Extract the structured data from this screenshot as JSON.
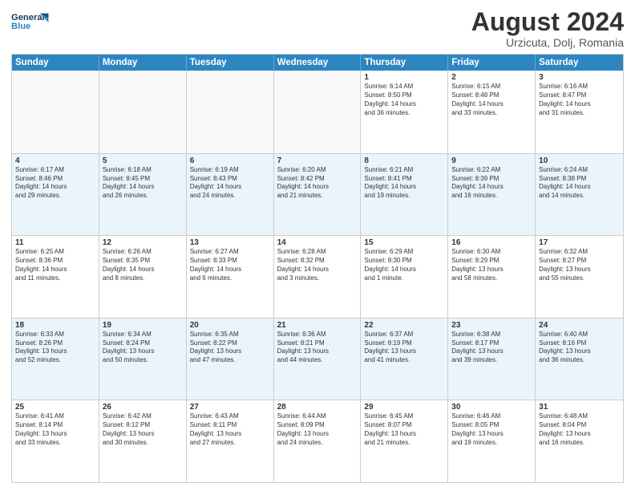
{
  "header": {
    "logo_general": "General",
    "logo_blue": "Blue",
    "month_year": "August 2024",
    "location": "Urzicuta, Dolj, Romania"
  },
  "days_of_week": [
    "Sunday",
    "Monday",
    "Tuesday",
    "Wednesday",
    "Thursday",
    "Friday",
    "Saturday"
  ],
  "weeks": [
    [
      {
        "day": "",
        "info": ""
      },
      {
        "day": "",
        "info": ""
      },
      {
        "day": "",
        "info": ""
      },
      {
        "day": "",
        "info": ""
      },
      {
        "day": "1",
        "info": "Sunrise: 6:14 AM\nSunset: 8:50 PM\nDaylight: 14 hours\nand 36 minutes."
      },
      {
        "day": "2",
        "info": "Sunrise: 6:15 AM\nSunset: 8:48 PM\nDaylight: 14 hours\nand 33 minutes."
      },
      {
        "day": "3",
        "info": "Sunrise: 6:16 AM\nSunset: 8:47 PM\nDaylight: 14 hours\nand 31 minutes."
      }
    ],
    [
      {
        "day": "4",
        "info": "Sunrise: 6:17 AM\nSunset: 8:46 PM\nDaylight: 14 hours\nand 29 minutes."
      },
      {
        "day": "5",
        "info": "Sunrise: 6:18 AM\nSunset: 8:45 PM\nDaylight: 14 hours\nand 26 minutes."
      },
      {
        "day": "6",
        "info": "Sunrise: 6:19 AM\nSunset: 8:43 PM\nDaylight: 14 hours\nand 24 minutes."
      },
      {
        "day": "7",
        "info": "Sunrise: 6:20 AM\nSunset: 8:42 PM\nDaylight: 14 hours\nand 21 minutes."
      },
      {
        "day": "8",
        "info": "Sunrise: 6:21 AM\nSunset: 8:41 PM\nDaylight: 14 hours\nand 19 minutes."
      },
      {
        "day": "9",
        "info": "Sunrise: 6:22 AM\nSunset: 8:39 PM\nDaylight: 14 hours\nand 16 minutes."
      },
      {
        "day": "10",
        "info": "Sunrise: 6:24 AM\nSunset: 8:38 PM\nDaylight: 14 hours\nand 14 minutes."
      }
    ],
    [
      {
        "day": "11",
        "info": "Sunrise: 6:25 AM\nSunset: 8:36 PM\nDaylight: 14 hours\nand 11 minutes."
      },
      {
        "day": "12",
        "info": "Sunrise: 6:26 AM\nSunset: 8:35 PM\nDaylight: 14 hours\nand 8 minutes."
      },
      {
        "day": "13",
        "info": "Sunrise: 6:27 AM\nSunset: 8:33 PM\nDaylight: 14 hours\nand 6 minutes."
      },
      {
        "day": "14",
        "info": "Sunrise: 6:28 AM\nSunset: 8:32 PM\nDaylight: 14 hours\nand 3 minutes."
      },
      {
        "day": "15",
        "info": "Sunrise: 6:29 AM\nSunset: 8:30 PM\nDaylight: 14 hours\nand 1 minute."
      },
      {
        "day": "16",
        "info": "Sunrise: 6:30 AM\nSunset: 8:29 PM\nDaylight: 13 hours\nand 58 minutes."
      },
      {
        "day": "17",
        "info": "Sunrise: 6:32 AM\nSunset: 8:27 PM\nDaylight: 13 hours\nand 55 minutes."
      }
    ],
    [
      {
        "day": "18",
        "info": "Sunrise: 6:33 AM\nSunset: 8:26 PM\nDaylight: 13 hours\nand 52 minutes."
      },
      {
        "day": "19",
        "info": "Sunrise: 6:34 AM\nSunset: 8:24 PM\nDaylight: 13 hours\nand 50 minutes."
      },
      {
        "day": "20",
        "info": "Sunrise: 6:35 AM\nSunset: 8:22 PM\nDaylight: 13 hours\nand 47 minutes."
      },
      {
        "day": "21",
        "info": "Sunrise: 6:36 AM\nSunset: 8:21 PM\nDaylight: 13 hours\nand 44 minutes."
      },
      {
        "day": "22",
        "info": "Sunrise: 6:37 AM\nSunset: 8:19 PM\nDaylight: 13 hours\nand 41 minutes."
      },
      {
        "day": "23",
        "info": "Sunrise: 6:38 AM\nSunset: 8:17 PM\nDaylight: 13 hours\nand 39 minutes."
      },
      {
        "day": "24",
        "info": "Sunrise: 6:40 AM\nSunset: 8:16 PM\nDaylight: 13 hours\nand 36 minutes."
      }
    ],
    [
      {
        "day": "25",
        "info": "Sunrise: 6:41 AM\nSunset: 8:14 PM\nDaylight: 13 hours\nand 33 minutes."
      },
      {
        "day": "26",
        "info": "Sunrise: 6:42 AM\nSunset: 8:12 PM\nDaylight: 13 hours\nand 30 minutes."
      },
      {
        "day": "27",
        "info": "Sunrise: 6:43 AM\nSunset: 8:11 PM\nDaylight: 13 hours\nand 27 minutes."
      },
      {
        "day": "28",
        "info": "Sunrise: 6:44 AM\nSunset: 8:09 PM\nDaylight: 13 hours\nand 24 minutes."
      },
      {
        "day": "29",
        "info": "Sunrise: 6:45 AM\nSunset: 8:07 PM\nDaylight: 13 hours\nand 21 minutes."
      },
      {
        "day": "30",
        "info": "Sunrise: 6:46 AM\nSunset: 8:05 PM\nDaylight: 13 hours\nand 19 minutes."
      },
      {
        "day": "31",
        "info": "Sunrise: 6:48 AM\nSunset: 8:04 PM\nDaylight: 13 hours\nand 16 minutes."
      }
    ]
  ]
}
